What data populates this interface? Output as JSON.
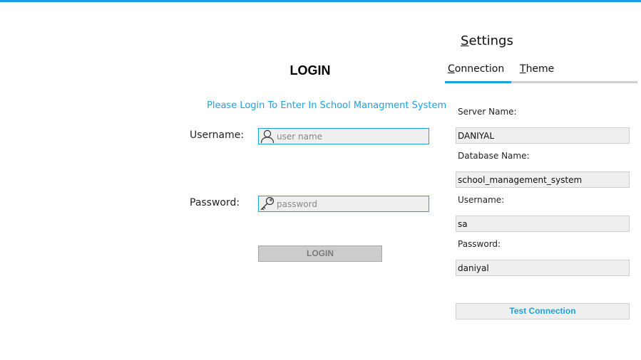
{
  "theme": {
    "accent_color": "#1ba1e2",
    "input_background": "#efefef",
    "disabled_button_background": "#cccccc"
  },
  "login": {
    "title": "LOGIN",
    "subtitle": "Please Login To Enter In School Managment System",
    "username_label": "Username:",
    "username_placeholder": "user name",
    "username_value": "",
    "username_icon": "user-icon",
    "password_label": "Password:",
    "password_placeholder": "password",
    "password_value": "",
    "password_icon": "key-icon",
    "button_label": "LOGIN"
  },
  "settings": {
    "title_mnemonic": "S",
    "title_rest": "ettings",
    "tabs": [
      {
        "mnemonic": "C",
        "rest": "onnection",
        "selected": true
      },
      {
        "mnemonic": "T",
        "rest": "heme",
        "selected": false
      }
    ],
    "connection": {
      "server_label": "Server Name:",
      "server_value": "DANIYAL",
      "database_label": "Database Name:",
      "database_value": "school_management_system",
      "username_label": "Username:",
      "username_value": "sa",
      "password_label": "Password:",
      "password_value": "daniyal",
      "test_button_label": "Test Connection"
    }
  }
}
